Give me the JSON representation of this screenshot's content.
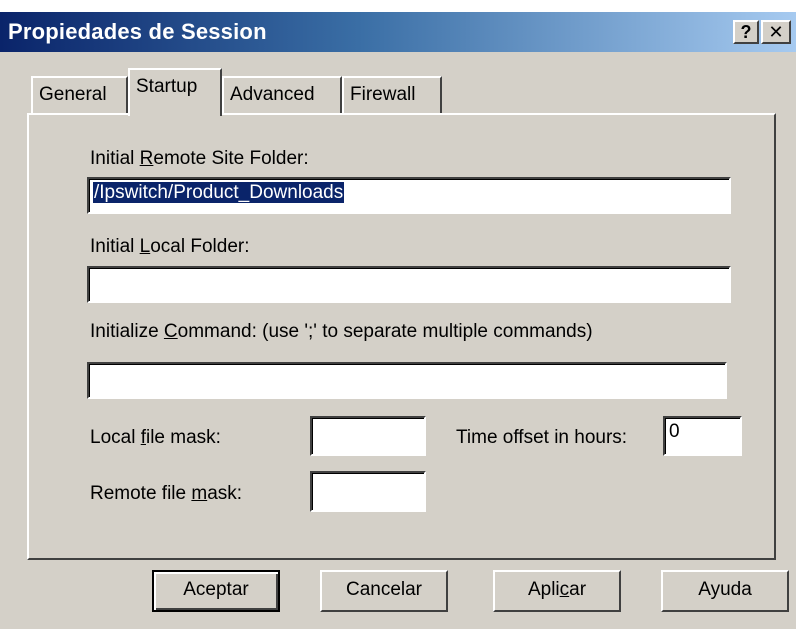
{
  "window": {
    "title": "Propiedades de Session",
    "help_glyph": "?",
    "close_glyph": "✕"
  },
  "tabs": [
    {
      "label": "General"
    },
    {
      "label": "Startup",
      "selected": true
    },
    {
      "label": "Advanced"
    },
    {
      "label": "Firewall"
    }
  ],
  "startup": {
    "remote_folder_label_pre": "Initial ",
    "remote_folder_label_key": "R",
    "remote_folder_label_post": "emote Site Folder:",
    "remote_folder_value": "/Ipswitch/Product_Downloads",
    "local_folder_label_pre": "Initial ",
    "local_folder_label_key": "L",
    "local_folder_label_post": "ocal Folder:",
    "local_folder_value": "",
    "command_label_pre": "Initialize ",
    "command_label_key": "C",
    "command_label_post": "ommand: (use ';' to separate multiple commands)",
    "command_value": "",
    "local_mask_label_pre": "Local ",
    "local_mask_label_key": "f",
    "local_mask_label_post": "ile mask:",
    "local_mask_value": "",
    "remote_mask_label_pre": "Remote file ",
    "remote_mask_label_key": "m",
    "remote_mask_label_post": "ask:",
    "remote_mask_value": "",
    "time_offset_label": "Time offset in hours:",
    "time_offset_value": "0"
  },
  "buttons": {
    "ok": "Aceptar",
    "cancel": "Cancelar",
    "apply_pre": "Apli",
    "apply_key": "c",
    "apply_post": "ar",
    "help": "Ayuda"
  },
  "colors": {
    "titlebar_start": "#0a246a",
    "titlebar_end": "#a6caf0",
    "selection": "#0a246a",
    "face": "#d4d0c8"
  }
}
